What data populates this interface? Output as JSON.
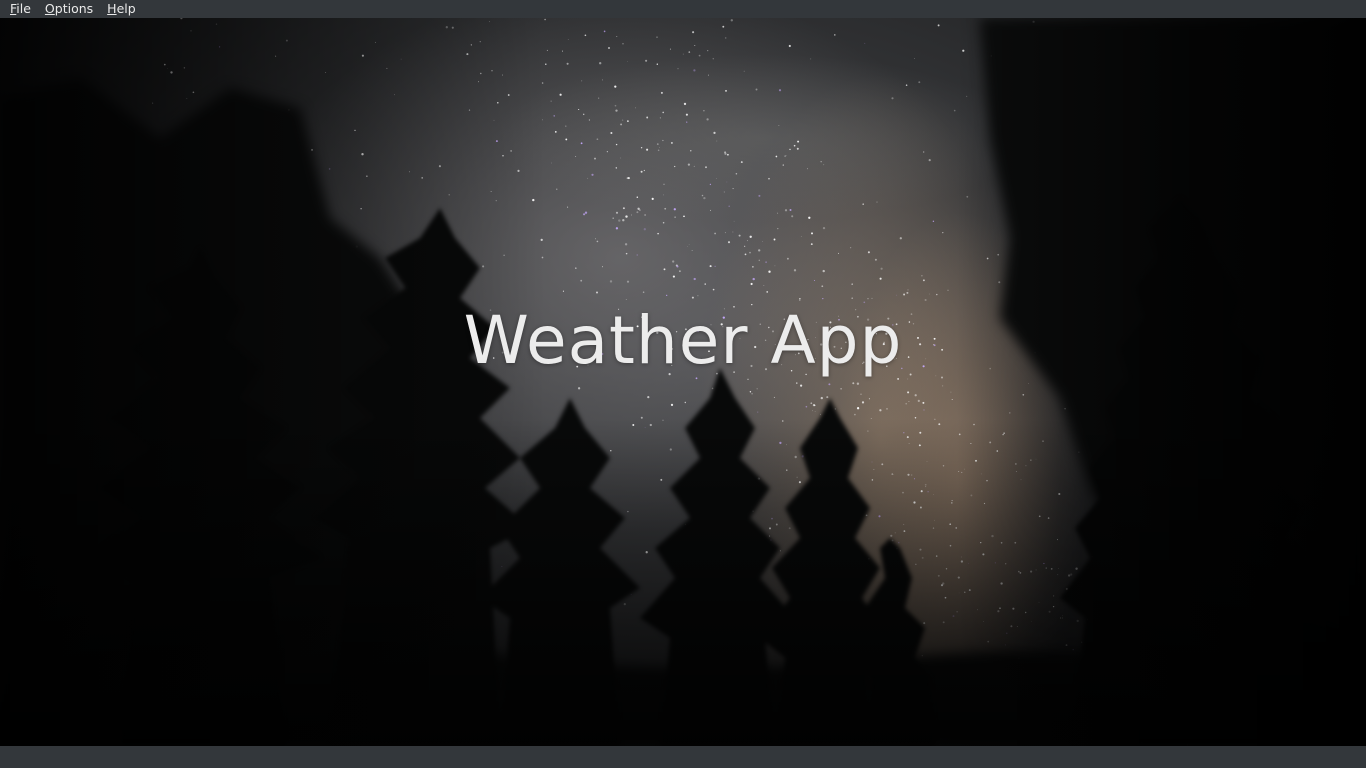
{
  "menubar": {
    "items": [
      {
        "mnemonic": "F",
        "rest": "ile"
      },
      {
        "mnemonic": "O",
        "rest": "ptions"
      },
      {
        "mnemonic": "H",
        "rest": "elp"
      }
    ]
  },
  "main": {
    "title": "Weather App"
  },
  "colors": {
    "menubar_bg": "#33373b",
    "menu_text": "#eaeaea",
    "title_text": "#ececec",
    "statusbar_bg": "#33373b"
  }
}
